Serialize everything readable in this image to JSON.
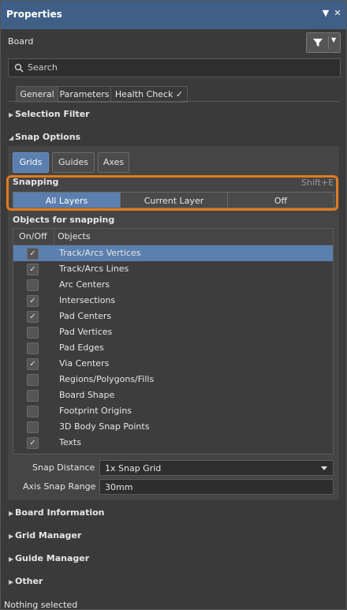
{
  "window": {
    "title": "Properties",
    "icons": [
      "dropdown-icon",
      "pin-icon",
      "close-icon"
    ]
  },
  "header": {
    "board_label": "Board"
  },
  "search": {
    "placeholder": "Search"
  },
  "tabs": [
    {
      "label": "General",
      "active": true
    },
    {
      "label": "Parameters",
      "active": false
    },
    {
      "label": "Health Check",
      "active": false
    }
  ],
  "sections": {
    "selection_filter": "Selection Filter",
    "snap_options": "Snap Options",
    "board_information": "Board Information",
    "grid_manager": "Grid Manager",
    "guide_manager": "Guide Manager",
    "other": "Other"
  },
  "snap_buttons": [
    {
      "label": "Grids",
      "active": true
    },
    {
      "label": "Guides",
      "active": false
    },
    {
      "label": "Axes",
      "active": false
    }
  ],
  "snapping": {
    "label": "Snapping",
    "shortcut": "Shift+E",
    "segments": [
      {
        "label": "All Layers",
        "active": true
      },
      {
        "label": "Current Layer",
        "active": false
      },
      {
        "label": "Off",
        "active": false
      }
    ]
  },
  "objects": {
    "title": "Objects for snapping",
    "col_onoff": "On/Off",
    "col_objects": "Objects",
    "rows": [
      {
        "label": "Track/Arcs Vertices",
        "checked": true,
        "selected": true
      },
      {
        "label": "Track/Arcs Lines",
        "checked": true,
        "selected": false
      },
      {
        "label": "Arc Centers",
        "checked": false,
        "selected": false
      },
      {
        "label": "Intersections",
        "checked": true,
        "selected": false
      },
      {
        "label": "Pad Centers",
        "checked": true,
        "selected": false
      },
      {
        "label": "Pad Vertices",
        "checked": false,
        "selected": false
      },
      {
        "label": "Pad Edges",
        "checked": false,
        "selected": false
      },
      {
        "label": "Via Centers",
        "checked": true,
        "selected": false
      },
      {
        "label": "Regions/Polygons/Fills",
        "checked": false,
        "selected": false
      },
      {
        "label": "Board Shape",
        "checked": false,
        "selected": false
      },
      {
        "label": "Footprint Origins",
        "checked": false,
        "selected": false
      },
      {
        "label": "3D Body Snap Points",
        "checked": false,
        "selected": false
      },
      {
        "label": "Texts",
        "checked": true,
        "selected": false
      }
    ]
  },
  "snap_distance": {
    "label": "Snap Distance",
    "value": "1x Snap Grid"
  },
  "axis_snap_range": {
    "label": "Axis Snap Range",
    "value": "30mm"
  },
  "status": "Nothing selected",
  "colors": {
    "accent": "#5b7fae",
    "highlight": "#e07a1f",
    "titlebar": "#3f5f86"
  }
}
